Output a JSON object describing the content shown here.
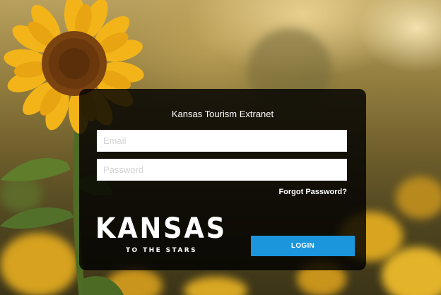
{
  "app": {
    "title": "Kansas Tourism Extranet"
  },
  "login_form": {
    "email_placeholder": "Email",
    "password_placeholder": "Password",
    "forgot_password_label": "Forgot Password?",
    "login_button_label": "LOGIN"
  },
  "logo": {
    "wordmark": "KANSAS",
    "tagline": "TO THE STARS"
  },
  "colors": {
    "accent": "#1b96dc",
    "card_background": "#000000",
    "text": "#ffffff"
  },
  "background": {
    "icon": "sunflower-field-photo"
  }
}
